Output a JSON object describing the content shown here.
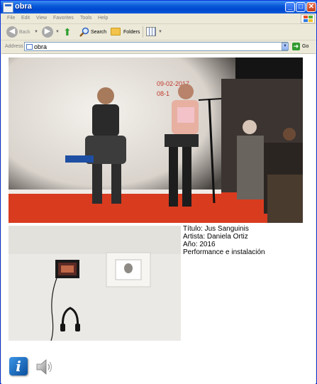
{
  "window": {
    "title": "obra"
  },
  "title_buttons": {
    "minimize": "_",
    "maximize": "□",
    "close": "✕"
  },
  "menu": [
    "File",
    "Edit",
    "View",
    "Favorites",
    "Tools",
    "Help"
  ],
  "toolbar": {
    "back_label": "Back",
    "search_label": "Search",
    "folders_label": "Folders"
  },
  "address": {
    "label": "Address",
    "value": "obra",
    "go_label": "Go"
  },
  "photo1": {
    "date_line1": "09-02-2017",
    "date_line2": "08-1"
  },
  "artwork": {
    "title": "Título: Jus Sanguinis",
    "artist": "Artista: Daniela Ortiz",
    "year": "Año:  2016",
    "medium": "Performance e instalación"
  },
  "footer": {
    "info_icon": "info-icon",
    "speaker_icon": "speaker-icon",
    "info_glyph": "i"
  }
}
